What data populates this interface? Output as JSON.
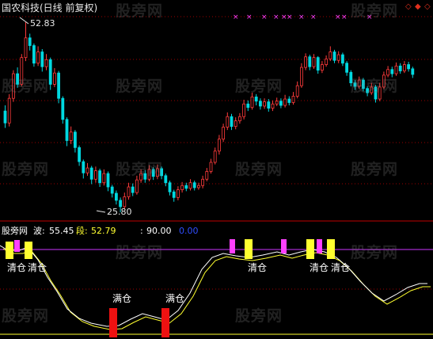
{
  "header": {
    "title": "国农科技(日线 前复权)",
    "nav_icons": [
      "diamond-icon",
      "diamond-icon",
      "diamond-icon"
    ],
    "nav_color": "#e0301e"
  },
  "price_chart": {
    "max_label": "52.83",
    "min_label": "25.80",
    "up_color": "#ff3b3b",
    "down_color": "#00d8e0",
    "grid_color": "#9a0000"
  },
  "indicator": {
    "name": "股旁网",
    "items": [
      {
        "label": "波:",
        "value": "55.45",
        "color": "#ffffff"
      },
      {
        "label": "段:",
        "value": "52.79",
        "color": "#ffff30"
      },
      {
        "label": ":",
        "value": "90.00",
        "color": "#ffffff"
      },
      {
        "label": "",
        "value": "0.00",
        "color": "#2f4dff"
      }
    ],
    "upper_line_color": "#cc33ff",
    "lower_line_color": "#ffff30",
    "signals": [
      {
        "text": "清仓",
        "kind": "sell"
      },
      {
        "text": "清仓",
        "kind": "sell"
      },
      {
        "text": "满仓",
        "kind": "buy"
      },
      {
        "text": "满仓",
        "kind": "buy"
      },
      {
        "text": "清仓",
        "kind": "sell"
      },
      {
        "text": "清仓",
        "kind": "sell"
      },
      {
        "text": "清仓",
        "kind": "sell"
      }
    ]
  },
  "watermarks": [
    "股旁网",
    "股旁网",
    "股旁网",
    "股旁网",
    "股旁网",
    "股旁网",
    "股旁网",
    "股旁网",
    "股旁网",
    "股旁网",
    "股旁网",
    "股旁网",
    "股旁网",
    "股旁网"
  ],
  "chart_data": {
    "type": "candlestick",
    "symbol": "国农科技",
    "period": "日线 前复权",
    "ylim": [
      25.8,
      52.83
    ],
    "candles": [
      [
        40.2,
        38.5,
        41.0,
        37.8
      ],
      [
        38.5,
        42.0,
        42.6,
        38.0
      ],
      [
        42.0,
        45.5,
        46.0,
        41.5
      ],
      [
        45.5,
        44.0,
        46.4,
        43.5
      ],
      [
        44.0,
        47.8,
        48.3,
        43.7
      ],
      [
        47.8,
        50.6,
        52.83,
        47.3
      ],
      [
        50.6,
        49.5,
        51.2,
        48.8
      ],
      [
        49.5,
        47.0,
        49.8,
        46.5
      ],
      [
        47.0,
        48.6,
        49.4,
        46.6
      ],
      [
        48.6,
        46.5,
        49.0,
        45.8
      ],
      [
        46.5,
        47.5,
        48.3,
        46.0
      ],
      [
        47.5,
        44.0,
        47.8,
        43.2
      ],
      [
        44.0,
        45.6,
        46.3,
        43.6
      ],
      [
        45.6,
        42.0,
        45.9,
        41.3
      ],
      [
        42.0,
        39.0,
        42.3,
        38.4
      ],
      [
        39.0,
        36.0,
        39.3,
        35.2
      ],
      [
        36.0,
        37.2,
        38.0,
        35.5
      ],
      [
        37.2,
        35.0,
        37.5,
        34.3
      ],
      [
        35.0,
        33.0,
        35.3,
        32.4
      ],
      [
        33.0,
        31.4,
        33.3,
        30.6
      ],
      [
        31.4,
        32.1,
        32.8,
        31.0
      ],
      [
        32.1,
        30.5,
        32.4,
        29.8
      ],
      [
        30.5,
        31.7,
        32.3,
        30.0
      ],
      [
        31.7,
        30.0,
        32.0,
        29.4
      ],
      [
        30.0,
        31.3,
        31.9,
        29.6
      ],
      [
        31.3,
        29.4,
        31.6,
        28.8
      ],
      [
        29.4,
        28.5,
        29.7,
        27.9
      ],
      [
        28.5,
        27.5,
        28.9,
        26.9
      ],
      [
        27.5,
        26.6,
        27.9,
        25.8
      ],
      [
        26.6,
        28.0,
        28.6,
        26.3
      ],
      [
        28.0,
        29.4,
        30.0,
        27.6
      ],
      [
        29.4,
        28.6,
        29.9,
        28.1
      ],
      [
        28.6,
        30.4,
        31.0,
        28.3
      ],
      [
        30.4,
        31.3,
        31.9,
        30.0
      ],
      [
        31.3,
        30.5,
        31.8,
        30.0
      ],
      [
        30.5,
        31.9,
        32.5,
        30.2
      ],
      [
        31.9,
        30.9,
        32.2,
        30.4
      ],
      [
        30.9,
        32.0,
        32.6,
        30.5
      ],
      [
        32.0,
        31.0,
        32.3,
        30.5
      ],
      [
        31.0,
        30.0,
        31.3,
        29.5
      ],
      [
        30.0,
        28.7,
        30.3,
        28.2
      ],
      [
        28.7,
        27.9,
        29.0,
        27.3
      ],
      [
        27.9,
        29.0,
        29.5,
        27.5
      ],
      [
        29.0,
        29.6,
        30.1,
        28.6
      ],
      [
        29.6,
        29.2,
        30.0,
        28.8
      ],
      [
        29.2,
        30.0,
        30.5,
        28.9
      ],
      [
        30.0,
        29.3,
        30.3,
        28.9
      ],
      [
        29.3,
        29.6,
        30.0,
        29.0
      ],
      [
        29.6,
        30.5,
        31.0,
        29.2
      ],
      [
        30.5,
        31.6,
        32.1,
        30.2
      ],
      [
        31.6,
        32.9,
        33.4,
        31.3
      ],
      [
        32.9,
        34.5,
        35.0,
        32.6
      ],
      [
        34.5,
        36.2,
        36.8,
        34.0
      ],
      [
        36.2,
        37.9,
        38.4,
        35.8
      ],
      [
        37.9,
        39.4,
        40.0,
        37.5
      ],
      [
        39.4,
        38.0,
        39.8,
        37.5
      ],
      [
        38.0,
        38.8,
        39.3,
        37.6
      ],
      [
        38.8,
        39.4,
        39.9,
        38.4
      ],
      [
        39.4,
        41.2,
        41.8,
        39.0
      ],
      [
        41.2,
        40.7,
        41.7,
        40.2
      ],
      [
        40.7,
        42.2,
        42.8,
        40.4
      ],
      [
        42.2,
        41.6,
        42.6,
        41.0
      ],
      [
        41.6,
        40.9,
        42.0,
        40.4
      ],
      [
        40.9,
        41.5,
        42.0,
        40.5
      ],
      [
        41.5,
        40.6,
        41.9,
        40.1
      ],
      [
        40.6,
        41.2,
        41.7,
        40.2
      ],
      [
        41.2,
        41.6,
        42.1,
        40.9
      ],
      [
        41.6,
        41.0,
        42.0,
        40.6
      ],
      [
        41.0,
        41.9,
        42.5,
        40.7
      ],
      [
        41.9,
        41.4,
        42.3,
        41.0
      ],
      [
        41.4,
        42.3,
        42.9,
        41.1
      ],
      [
        42.3,
        43.8,
        44.4,
        42.0
      ],
      [
        43.8,
        46.4,
        47.0,
        43.5
      ],
      [
        46.4,
        47.9,
        48.4,
        46.0
      ],
      [
        47.9,
        46.5,
        48.2,
        46.0
      ],
      [
        46.5,
        47.8,
        48.3,
        46.2
      ],
      [
        47.8,
        46.0,
        48.0,
        45.5
      ],
      [
        46.0,
        46.8,
        47.3,
        45.6
      ],
      [
        46.8,
        47.6,
        48.1,
        46.5
      ],
      [
        47.6,
        48.6,
        49.4,
        47.3
      ],
      [
        48.6,
        47.4,
        48.9,
        47.0
      ],
      [
        47.4,
        48.2,
        48.7,
        47.0
      ],
      [
        48.2,
        47.0,
        48.5,
        46.6
      ],
      [
        47.0,
        45.7,
        47.3,
        45.2
      ],
      [
        45.7,
        44.2,
        46.0,
        43.7
      ],
      [
        44.2,
        43.7,
        44.6,
        43.2
      ],
      [
        43.7,
        44.6,
        45.1,
        43.4
      ],
      [
        44.6,
        43.4,
        44.9,
        43.0
      ],
      [
        43.4,
        42.8,
        43.7,
        42.3
      ],
      [
        42.8,
        43.6,
        44.2,
        42.5
      ],
      [
        43.6,
        41.9,
        43.9,
        41.4
      ],
      [
        41.9,
        43.6,
        44.2,
        41.6
      ],
      [
        43.6,
        45.3,
        45.8,
        43.3
      ],
      [
        45.3,
        46.1,
        46.6,
        45.0
      ],
      [
        46.1,
        45.5,
        46.5,
        45.0
      ],
      [
        45.5,
        46.6,
        47.1,
        45.2
      ],
      [
        46.6,
        45.9,
        47.0,
        45.5
      ],
      [
        45.9,
        46.8,
        47.3,
        45.6
      ],
      [
        46.8,
        46.2,
        47.2,
        45.8
      ],
      [
        46.2,
        45.4,
        46.5,
        44.9
      ]
    ],
    "xlabel": "",
    "ylabel": ""
  }
}
